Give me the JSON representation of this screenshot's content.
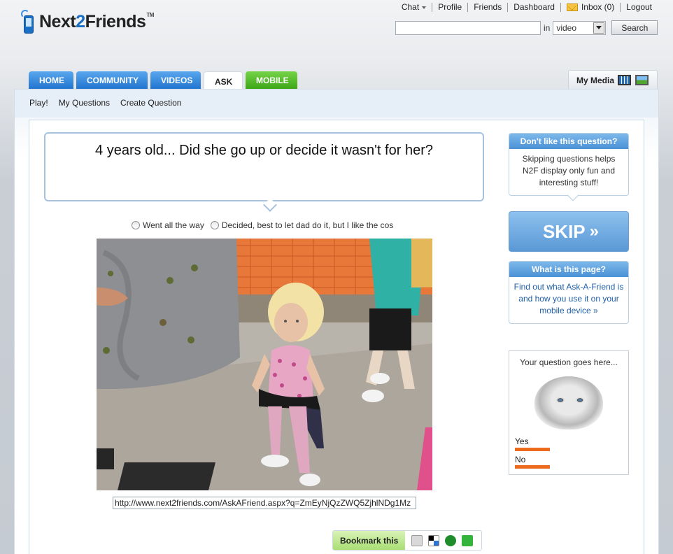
{
  "logo": {
    "name_part1": "Next",
    "name_part2": "2",
    "name_part3": "Friends",
    "tm": "TM"
  },
  "topnav": {
    "chat": "Chat",
    "profile": "Profile",
    "friends": "Friends",
    "dashboard": "Dashboard",
    "inbox": "Inbox (0)",
    "logout": "Logout"
  },
  "search": {
    "query": "",
    "in_label": "in",
    "scope_selected": "video",
    "button": "Search"
  },
  "tabs": [
    {
      "label": "HOME"
    },
    {
      "label": "COMMUNITY"
    },
    {
      "label": "VIDEOS"
    },
    {
      "label": "ASK"
    },
    {
      "label": "MOBILE"
    }
  ],
  "mymedia": {
    "label": "My Media"
  },
  "subnav": {
    "play": "Play!",
    "my_questions": "My Questions",
    "create_question": "Create Question"
  },
  "question": {
    "text": "4 years old... Did she go up or decide it wasn't for her?",
    "answers": [
      "Went all the way",
      "Decided, best to let dad do it, but I like the cos"
    ],
    "url": "http://www.next2friends.com/AskAFriend.aspx?q=ZmEyNjQzZWQ5ZjhlNDg1Mz"
  },
  "bookmark": {
    "label": "Bookmark this"
  },
  "sidebar": {
    "dislike": {
      "title": "Don't like this question?",
      "body": "Skipping questions helps N2F display only fun and interesting stuff!"
    },
    "skip": {
      "label": "SKIP",
      "arrows": "»"
    },
    "about": {
      "title": "What is this page?",
      "body": "Find out what Ask-A-Friend is and how you use it on your mobile device »"
    },
    "ad": {
      "title": "Your question goes here...",
      "yes": "Yes",
      "no": "No",
      "yes_share": 0.5,
      "no_share": 0.5,
      "bar_color": "#ee6a1f"
    }
  },
  "colors": {
    "tab_blue": "#1f73cf",
    "tab_green": "#3aa414",
    "skip_blue": "#5a98d6"
  }
}
